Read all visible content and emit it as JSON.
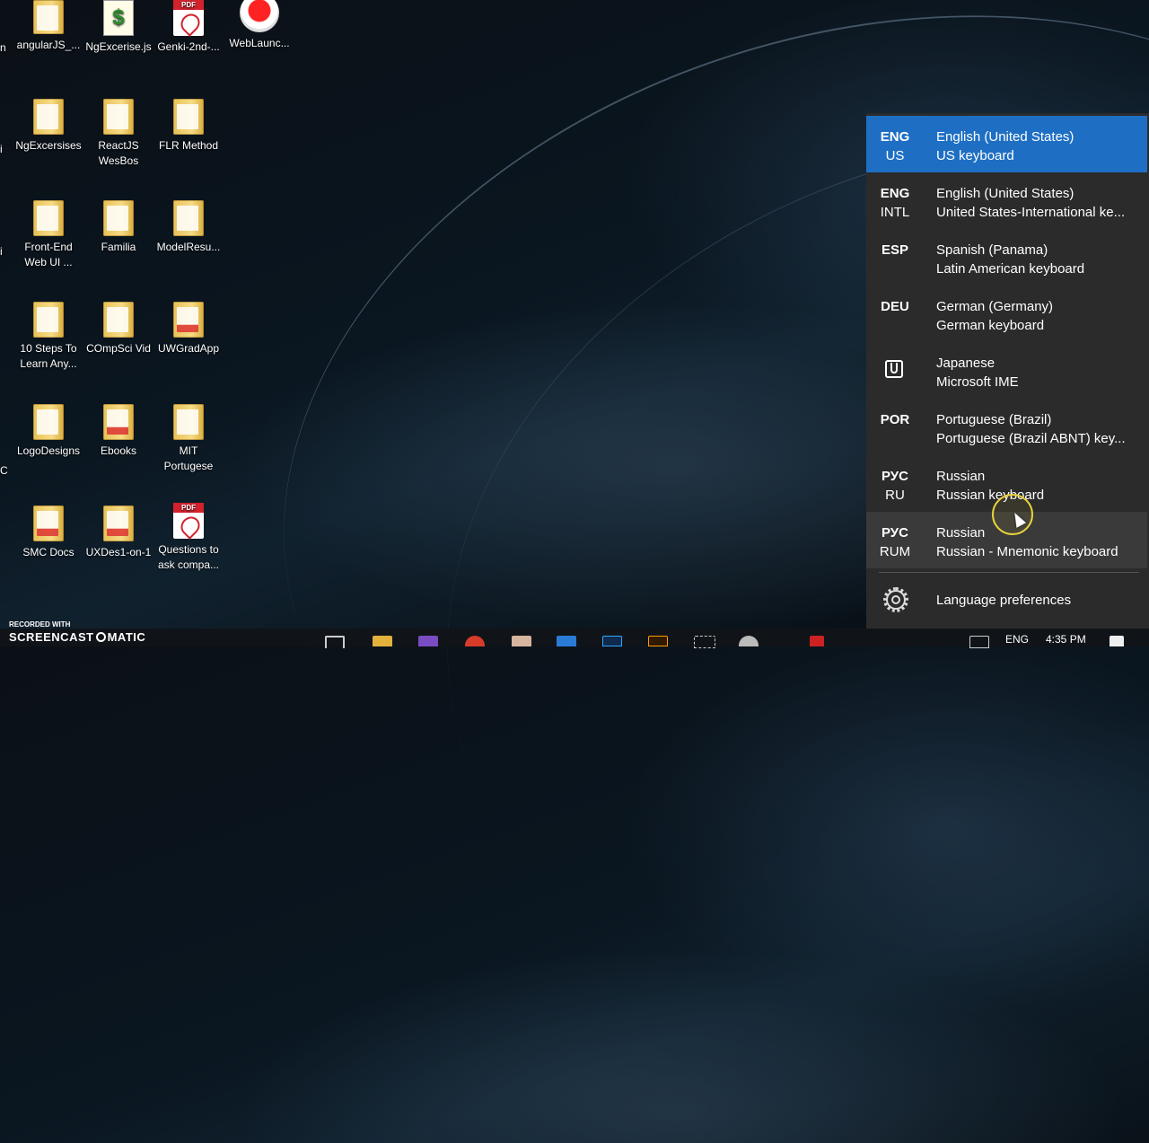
{
  "desktop": {
    "icons": [
      {
        "label": "angularJS_...",
        "type": "file"
      },
      {
        "label": "NgExcerise.js",
        "type": "js"
      },
      {
        "label": "Genki-2nd-...",
        "type": "pdf"
      },
      {
        "label": "WebLaunc...",
        "type": "record"
      },
      {
        "label": "NgExcersises",
        "type": "folder"
      },
      {
        "label": "ReactJS WesBos",
        "type": "folder"
      },
      {
        "label": "FLR Method",
        "type": "folder"
      },
      {
        "label": "Front-End Web  UI ...",
        "type": "folder"
      },
      {
        "label": "Familia",
        "type": "folder"
      },
      {
        "label": "ModelResu...",
        "type": "folder"
      },
      {
        "label": "10 Steps To Learn Any...",
        "type": "folder"
      },
      {
        "label": "COmpSci Vid",
        "type": "folder"
      },
      {
        "label": "UWGradApp",
        "type": "folder"
      },
      {
        "label": "LogoDesigns",
        "type": "folder"
      },
      {
        "label": "Ebooks",
        "type": "folder"
      },
      {
        "label": "MIT Portugese",
        "type": "folder"
      },
      {
        "label": "SMC Docs",
        "type": "folder"
      },
      {
        "label": "UXDes1-on-1",
        "type": "folder"
      },
      {
        "label": "Questions to ask compa...",
        "type": "pdf"
      }
    ],
    "cut_labels": [
      "n",
      "i",
      "i",
      "C"
    ]
  },
  "language_flyout": {
    "items": [
      {
        "code": "ENG",
        "sub": "US",
        "name": "English (United States)",
        "keyboard": "US keyboard",
        "selected": true
      },
      {
        "code": "ENG",
        "sub": "INTL",
        "name": "English (United States)",
        "keyboard": "United States-International ke..."
      },
      {
        "code": "ESP",
        "sub": "",
        "name": "Spanish (Panama)",
        "keyboard": "Latin American keyboard"
      },
      {
        "code": "DEU",
        "sub": "",
        "name": "German (Germany)",
        "keyboard": "German keyboard"
      },
      {
        "code": "",
        "sub": "",
        "name": "Japanese",
        "keyboard": "Microsoft IME",
        "icon": "ime-icon"
      },
      {
        "code": "POR",
        "sub": "",
        "name": "Portuguese (Brazil)",
        "keyboard": "Portuguese (Brazil ABNT) key..."
      },
      {
        "code": "РУС",
        "sub": "RU",
        "name": "Russian",
        "keyboard": "Russian keyboard"
      },
      {
        "code": "РУС",
        "sub": "RUM",
        "name": "Russian",
        "keyboard": "Russian - Mnemonic keyboard",
        "hover": true
      }
    ],
    "preferences_label": "Language preferences",
    "preferences_icon": "gear-icon"
  },
  "taskbar": {
    "language_indicator": "ENG",
    "clock": "4:35 PM",
    "pinned_icons": [
      "task-view-icon",
      "file-explorer-icon",
      "visual-studio-icon",
      "chrome-icon",
      "paint-icon",
      "store-icon",
      "photoshop-icon",
      "illustrator-icon",
      "snipping-icon",
      "settings-icon"
    ]
  },
  "watermark": {
    "line1": "RECORDED WITH",
    "line2a": "SCREENCAST",
    "line2b": "MATIC"
  },
  "colors": {
    "accent": "#1e6fc4",
    "flyout_bg": "#2b2b2b",
    "cursor_highlight": "#e8d23a"
  }
}
